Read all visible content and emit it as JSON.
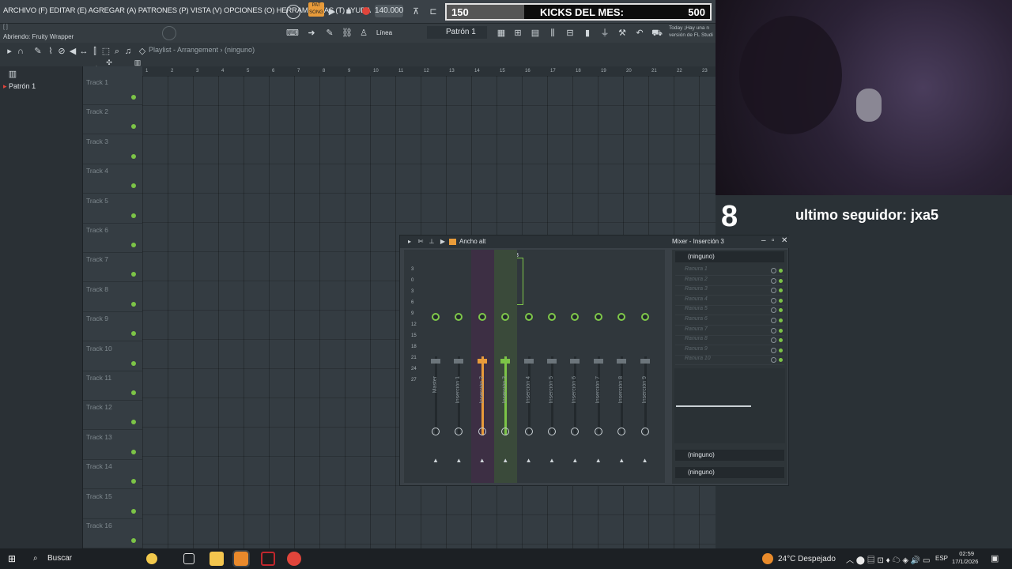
{
  "menu": {
    "items": [
      "ARCHIVO (F)",
      "EDITAR (E)",
      "AGREGAR (A)",
      "PATRONES (P)",
      "VISTA (V)",
      "OPCIONES (O)",
      "HERRAMIENTAS (T)",
      "AYUDA"
    ],
    "line": "ARCHIVO (F) EDITAR (E) AGREGAR (A) PATRONES (P) VISTA (V) OPCIONES (O) HERRAMIENTAS (T) AYUDA"
  },
  "transport": {
    "pat_label": "PAT",
    "song_label": "SONG",
    "tempo": "140.000",
    "snap": "Línea",
    "pattern": "Patrón 1"
  },
  "hint": {
    "line1": "[  ]",
    "line2": "Abriendo: Fruity Wrapper"
  },
  "news": {
    "line1": "Today  ¡Hay una n",
    "line2": "versión de FL Studi"
  },
  "overlay": {
    "kicks_left": "150",
    "kicks_label": "KICKS DEL MES:",
    "kicks_right": "500",
    "counter": "8",
    "follower": "ultimo seguidor: jxa5"
  },
  "playlist": {
    "breadcrumb": "Playlist - Arrangement › (ninguno)",
    "pattern_item": "Patrón 1",
    "ruler": [
      "1",
      "2",
      "3",
      "4",
      "5",
      "6",
      "7",
      "8",
      "9",
      "10",
      "11",
      "12",
      "13",
      "14",
      "15",
      "16",
      "17",
      "18",
      "19",
      "20",
      "21",
      "22",
      "23"
    ],
    "tracks": [
      "Track 1",
      "Track 2",
      "Track 3",
      "Track 4",
      "Track 5",
      "Track 6",
      "Track 7",
      "Track 8",
      "Track 9",
      "Track 10",
      "Track 11",
      "Track 12",
      "Track 13",
      "Track 14",
      "Track 15",
      "Track 16"
    ]
  },
  "mixer": {
    "preset": "Ancho alt",
    "title": "Mixer - Inserción 3",
    "selected_header": "3",
    "scale": [
      "3",
      "0",
      "3",
      "6",
      "9",
      "12",
      "15",
      "18",
      "21",
      "24",
      "27"
    ],
    "strips": [
      "Master",
      "Inserción 1",
      "Inserción 2",
      "Inserción 3",
      "Inserción 4",
      "Inserción 5",
      "Inserción 6",
      "Inserción 7",
      "Inserción 8",
      "Inserción 9"
    ],
    "slot_select": "(ninguno)",
    "slots": [
      "Ranura 1",
      "Ranura 2",
      "Ranura 3",
      "Ranura 4",
      "Ranura 5",
      "Ranura 6",
      "Ranura 7",
      "Ranura 8",
      "Ranura 9",
      "Ranura 10"
    ],
    "out_in": "(ninguno)",
    "out_out": "(ninguno)"
  },
  "taskbar": {
    "search": "Buscar",
    "weather": "24°C  Despejado",
    "lang": "ESP",
    "time": "02:59",
    "date": "17/1/2026"
  },
  "colors": {
    "accent_green": "#7cc447",
    "accent_orange": "#e89b3a",
    "record_red": "#e0453b"
  }
}
